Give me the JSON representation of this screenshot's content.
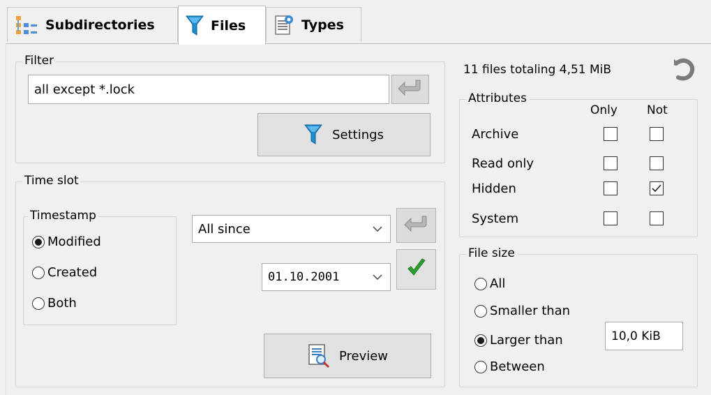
{
  "tabs": [
    {
      "label": "Subdirectories",
      "icon": "tree-icon"
    },
    {
      "label": "Files",
      "icon": "filter-icon"
    },
    {
      "label": "Types",
      "icon": "document-gear-icon"
    }
  ],
  "filter": {
    "legend": "Filter",
    "value": "all except *.lock",
    "settings_label": "Settings"
  },
  "time_slot": {
    "legend": "Time slot",
    "timestamp_legend": "Timestamp",
    "options": [
      "Modified",
      "Created",
      "Both"
    ],
    "selected": "Modified",
    "range_select": "All since",
    "date": "01.10.2001"
  },
  "preview_label": "Preview",
  "summary": "11 files totaling 4,51 MiB",
  "attributes": {
    "legend": "Attributes",
    "col_only": "Only",
    "col_not": "Not",
    "rows": [
      {
        "label": "Archive",
        "only": false,
        "not": false
      },
      {
        "label": "Read only",
        "only": false,
        "not": false
      },
      {
        "label": "Hidden",
        "only": false,
        "not": true
      },
      {
        "label": "System",
        "only": false,
        "not": false
      }
    ]
  },
  "file_size": {
    "legend": "File size",
    "options": [
      "All",
      "Smaller than",
      "Larger than",
      "Between"
    ],
    "selected": "Larger than",
    "value": "10,0 KiB"
  },
  "colors": {
    "accent_blue": "#1f8ccf",
    "check_green": "#2e9e2e"
  }
}
